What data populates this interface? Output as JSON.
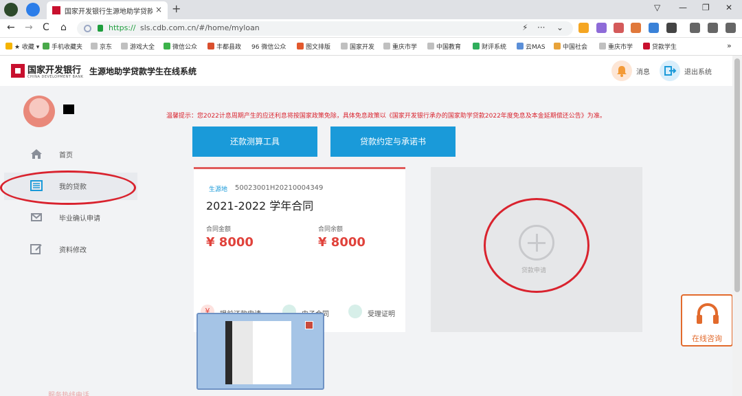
{
  "browser": {
    "tab_title": "国家开发银行生源地助学贷款",
    "tab_close": "×",
    "new_tab": "+",
    "url_scheme": "https://",
    "url_host": "sls.cdb.com.cn/#/home/myloan",
    "nav_back": "←",
    "nav_forward": "→",
    "nav_reload": "C",
    "nav_home": "⌂",
    "addr_more": "···",
    "addr_dropdown": "⌄",
    "addr_bolt": "⚡",
    "win_min": "—",
    "win_max": "❐",
    "win_close": "✕",
    "tab_menu": "▽",
    "bookmarks_more": "»"
  },
  "bookmarks": [
    {
      "label": "★ 收藏 ▾",
      "color": "#f5b400"
    },
    {
      "label": "手机收藏夹",
      "color": "#49a94a"
    },
    {
      "label": "京东",
      "color": "#c0c0c0"
    },
    {
      "label": "游戏大全",
      "color": "#c0c0c0"
    },
    {
      "label": "微信公众",
      "color": "#3cb34a"
    },
    {
      "label": "丰都县政",
      "color": "#d94f2e"
    },
    {
      "label": "96 微信公众",
      "color": "#3cb34a"
    },
    {
      "label": "图文排版",
      "color": "#e2582d"
    },
    {
      "label": "国家开发",
      "color": "#c0c0c0"
    },
    {
      "label": "重庆市学",
      "color": "#c0c0c0"
    },
    {
      "label": "中国教育",
      "color": "#c0c0c0"
    },
    {
      "label": "财评系统",
      "color": "#2fae5b"
    },
    {
      "label": "云MAS",
      "color": "#5b8fd8"
    },
    {
      "label": "中国社会",
      "color": "#e8a33a"
    },
    {
      "label": "重庆市学",
      "color": "#c0c0c0"
    },
    {
      "label": "贷款学生",
      "color": "#c8102e"
    }
  ],
  "header": {
    "logo_cn": "国家开发银行",
    "logo_en": "CHINA DEVELOPMENT BANK",
    "system_title": "生源地助学贷款学生在线系统",
    "messages_label": "消息",
    "logout_label": "退出系统"
  },
  "sidebar": {
    "items": [
      {
        "label": "首页"
      },
      {
        "label": "我的贷款"
      },
      {
        "label": "毕业确认申请"
      },
      {
        "label": "资料修改"
      }
    ]
  },
  "notice": "温馨提示：您2022计息周期产生的应还利息将按国家政策免除，具体免息政策以《国家开发银行承办的国家助学贷款2022年度免息及本金延期偿还公告》为准。",
  "buttons": {
    "calculator": "还款测算工具",
    "agreement": "贷款约定与承诺书"
  },
  "loan_card": {
    "badge": "生源地",
    "contract_no": "50023001H20210004349",
    "title": "2021-2022 学年合同",
    "amount_label": "合同金额",
    "amount": "¥ 8000",
    "balance_label": "合同余额",
    "balance": "¥ 8000",
    "actions": [
      {
        "label": "提前还款申请",
        "color": "#f2b8b0"
      },
      {
        "label": "电子合同",
        "color": "#bfe3da"
      },
      {
        "label": "受理证明",
        "color": "#bfe3da"
      }
    ]
  },
  "apply": {
    "label": "贷款申请"
  },
  "consult": {
    "label": "在线咨询"
  },
  "faded_footer": "服务热线电话",
  "colors": {
    "accent_blue": "#1a9ad9",
    "brand_red": "#c8102e",
    "annotation_red": "#d9232e",
    "amount_red": "#e0423b",
    "consult_orange": "#e26a2c"
  },
  "icons": {
    "nav": [
      "home-icon",
      "loan-list-icon",
      "graduation-icon",
      "edit-icon"
    ],
    "header": [
      "bell-icon",
      "logout-icon"
    ]
  }
}
